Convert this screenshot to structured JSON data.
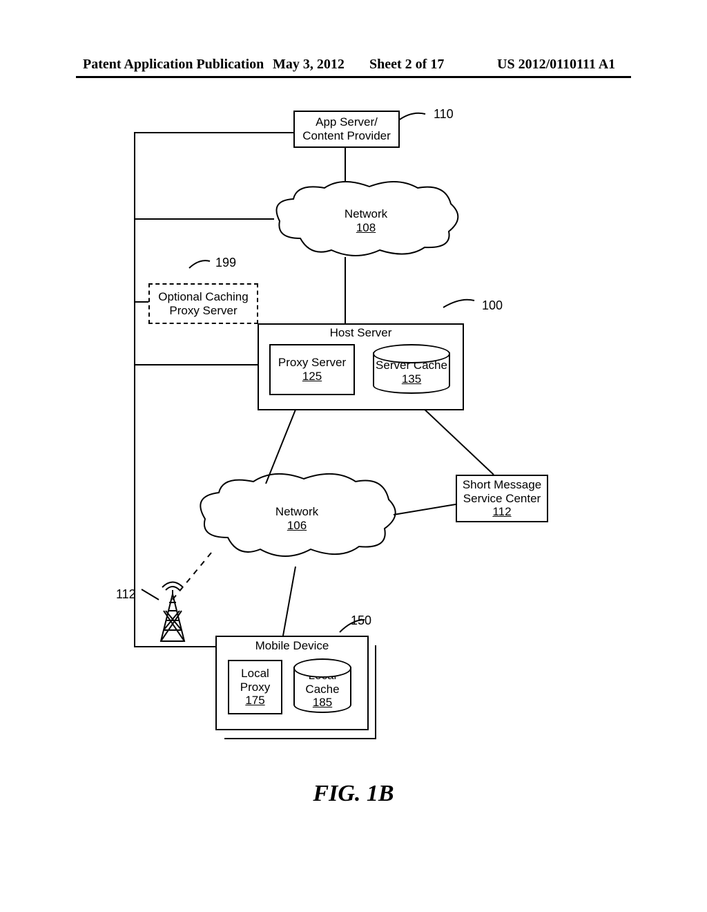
{
  "header": {
    "publication_label": "Patent Application Publication",
    "date": "May 3, 2012",
    "sheet": "Sheet 2 of 17",
    "publication_number": "US 2012/0110111 A1"
  },
  "figure_caption": "FIG. 1B",
  "nodes": {
    "app_server": {
      "title": "App Server/",
      "subtitle": "Content Provider",
      "ref": "110"
    },
    "network_top": {
      "title": "Network",
      "id": "108"
    },
    "optional_proxy": {
      "line1": "Optional Caching",
      "line2": "Proxy Server",
      "ref": "199"
    },
    "host_server": {
      "title": "Host Server",
      "ref": "100"
    },
    "proxy_server": {
      "title": "Proxy Server",
      "id": "125"
    },
    "server_cache": {
      "title": "Server Cache",
      "id": "135"
    },
    "network_bottom": {
      "title": "Network",
      "id": "106"
    },
    "smsc": {
      "line1": "Short Message",
      "line2": "Service Center",
      "id": "112"
    },
    "mobile_device": {
      "title": "Mobile Device",
      "ref": "150"
    },
    "local_proxy": {
      "line1": "Local",
      "line2": "Proxy",
      "id": "175"
    },
    "local_cache": {
      "line1": "Local",
      "line2": "Cache",
      "id": "185"
    },
    "tower": {
      "ref": "112"
    }
  }
}
